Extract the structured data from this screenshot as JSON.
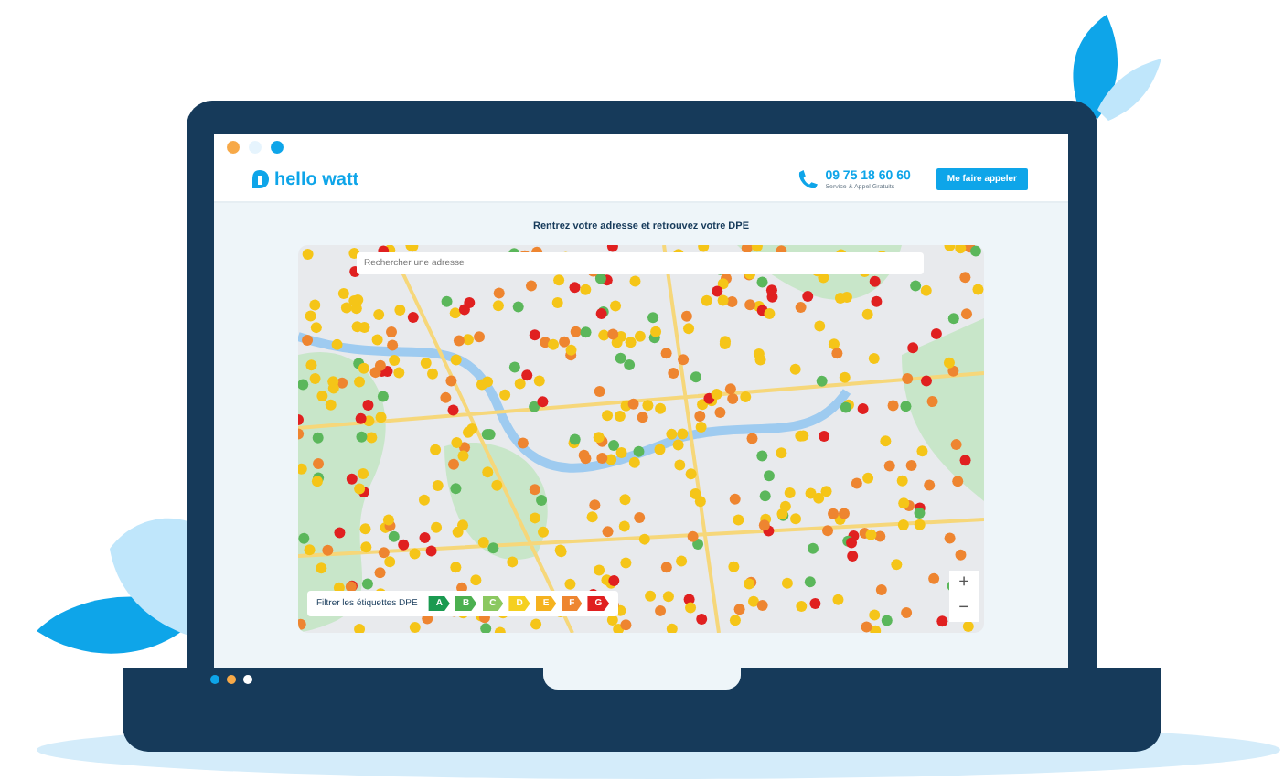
{
  "browser_dots": [
    {
      "color": "#f7a948"
    },
    {
      "color": "#e6f4fd"
    },
    {
      "color": "#0ea5e9"
    }
  ],
  "header": {
    "logo": "hello watt",
    "phone": "09 75 18 60 60",
    "phone_note": "Service & Appel Gratuits",
    "call_button": "Me faire appeler"
  },
  "heading": "Rentrez votre adresse et retrouvez votre DPE",
  "map": {
    "search": {
      "placeholder": "Rechercher une adresse"
    },
    "filter": {
      "label": "Filtrer les étiquettes DPE",
      "labels": [
        {
          "text": "A",
          "color": "#1a9a50"
        },
        {
          "text": "B",
          "color": "#4cb050"
        },
        {
          "text": "C",
          "color": "#8bc860"
        },
        {
          "text": "D",
          "color": "#f5d020"
        },
        {
          "text": "E",
          "color": "#f5b220"
        },
        {
          "text": "F",
          "color": "#ee8530"
        },
        {
          "text": "G",
          "color": "#e02020"
        }
      ]
    },
    "zoom_in": "+",
    "zoom_out": "−"
  },
  "base_dots": [
    {
      "color": "#0ea5e9"
    },
    {
      "color": "#f7a948"
    },
    {
      "color": "#ffffff"
    }
  ]
}
